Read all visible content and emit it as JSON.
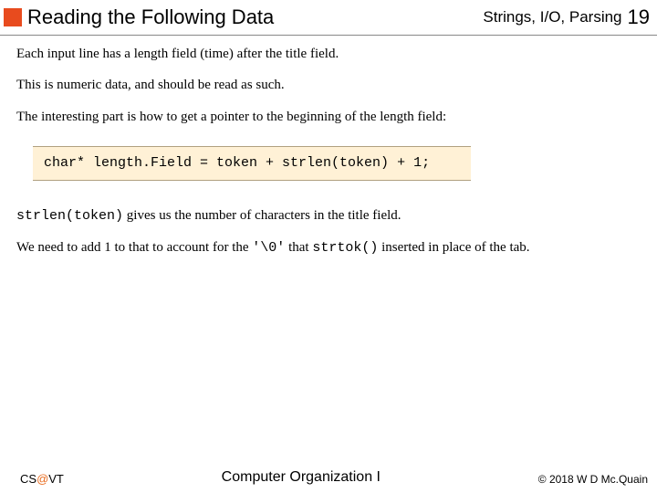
{
  "header": {
    "title": "Reading the Following Data",
    "topic": "Strings, I/O, Parsing",
    "page": "19"
  },
  "body": {
    "p1": "Each input line has a length field (time) after the title field.",
    "p2": "This is numeric data, and should be read as such.",
    "p3": "The interesting part is how to get a pointer to the beginning of the length field:",
    "code": "char* length.Field = token + strlen(token) + 1;",
    "p4a": "strlen(token)",
    "p4b": " gives us the number of characters in the title field.",
    "p5a": "We need to add 1 to that to account for the ",
    "p5b": "'\\0'",
    "p5c": " that ",
    "p5d": "strtok()",
    "p5e": " inserted in place of the tab."
  },
  "footer": {
    "left_pre": "CS",
    "left_at": "@",
    "left_post": "VT",
    "center": "Computer Organization I",
    "right": "© 2018 W D Mc.Quain"
  }
}
